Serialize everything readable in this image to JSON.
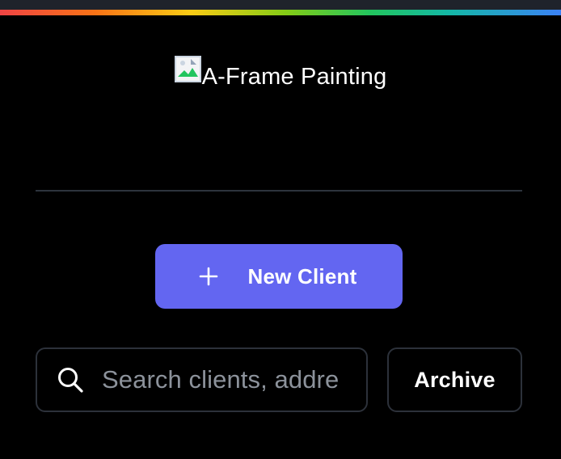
{
  "header": {
    "logo_alt_text": "A-Frame Painting"
  },
  "actions": {
    "new_client_label": "New Client"
  },
  "search": {
    "placeholder": "Search clients, addre",
    "value": ""
  },
  "archive": {
    "label": "Archive"
  },
  "icons": {
    "broken_image": "broken-image-icon",
    "plus": "plus-icon",
    "search": "search-icon"
  },
  "colors": {
    "background": "#000000",
    "primary": "#6366f1",
    "border": "#2c313a",
    "divider": "#2d333d",
    "placeholder": "#8c929b",
    "text": "#ffffff"
  }
}
